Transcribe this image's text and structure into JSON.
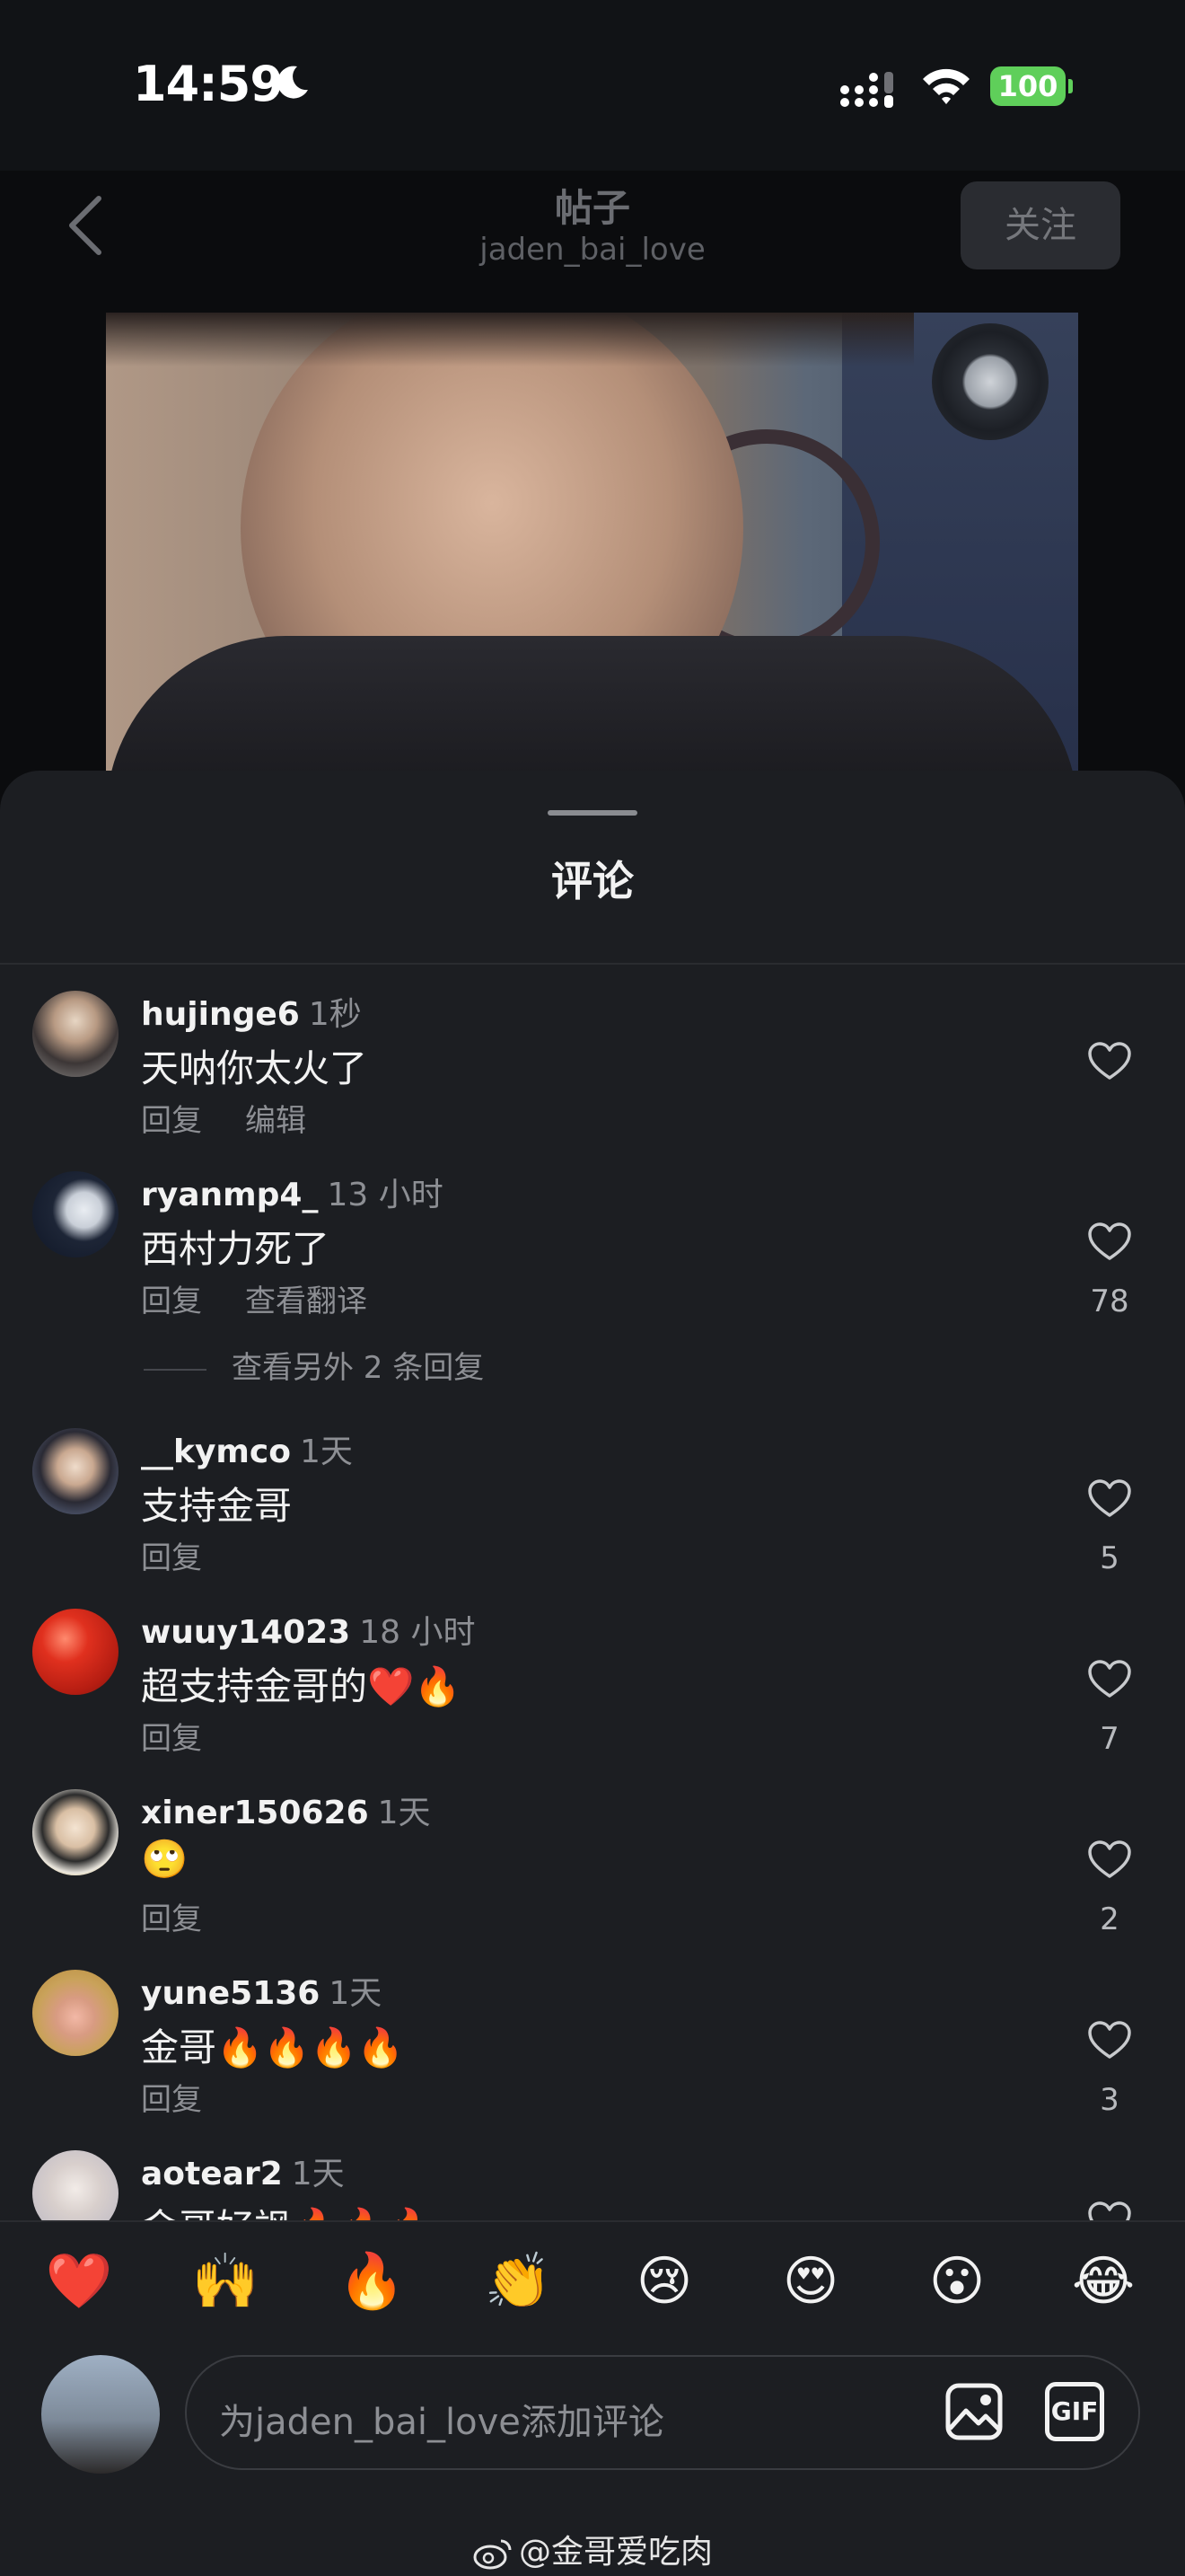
{
  "status_bar": {
    "time": "14:59",
    "battery": "100"
  },
  "header": {
    "title": "帖子",
    "author": "jaden_bai_love",
    "follow_label": "关注"
  },
  "sheet": {
    "title": "评论"
  },
  "comments": [
    {
      "user": "hujinge6",
      "time": "1秒",
      "text": "天呐你太火了",
      "actions": [
        "回复",
        "编辑"
      ],
      "likes": ""
    },
    {
      "user": "ryanmp4_",
      "time": "13 小时",
      "text": "西村力死了",
      "actions": [
        "回复",
        "查看翻译"
      ],
      "likes": "78",
      "more_replies": "查看另外 2 条回复"
    },
    {
      "user": "__kymco",
      "time": "1天",
      "text": "支持金哥",
      "actions": [
        "回复"
      ],
      "likes": "5"
    },
    {
      "user": "wuuy14023",
      "time": "18 小时",
      "text": "超支持金哥的❤️🔥",
      "actions": [
        "回复"
      ],
      "likes": "7"
    },
    {
      "user": "xiner150626",
      "time": "1天",
      "text": "🙄",
      "actions": [
        "回复"
      ],
      "likes": "2"
    },
    {
      "user": "yune5136",
      "time": "1天",
      "text": "金哥🔥🔥🔥🔥",
      "actions": [
        "回复"
      ],
      "likes": "3"
    },
    {
      "user": "aotear2",
      "time": "1天",
      "text": "金哥好飒🔥🔥🔥",
      "actions": [],
      "likes": ""
    }
  ],
  "emoji_bar": [
    "❤️",
    "🙌",
    "🔥",
    "👏",
    "😢",
    "😍",
    "😮",
    "😂"
  ],
  "composer": {
    "placeholder": "为jaden_bai_love添加评论",
    "gif_label": "GIF"
  },
  "watermark": "@金哥爱吃肉",
  "colors": {
    "background": "#0b0c0e",
    "sheet": "#1c1e22",
    "battery": "#5fcf5a",
    "muted_text": "#8d8f94"
  }
}
